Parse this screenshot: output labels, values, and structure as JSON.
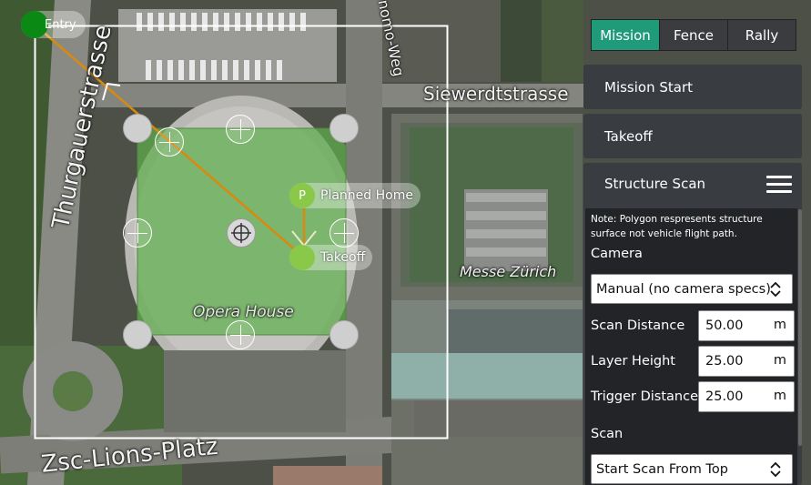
{
  "map": {
    "labels": {
      "thurgauerstrasse": "Thurgauerstrasse",
      "siewerdtstrasse": "Siewerdtstrasse",
      "homo_weg": "nomo-Weg",
      "messe_zurich": "Messe Zürich",
      "opera_house": "Opera House",
      "zsc_lions_platz": "Zsc-Lions-Platz"
    },
    "entry_label": "Entry",
    "planned_home": {
      "letter": "P",
      "label": "Planned Home"
    },
    "takeoff_label": "Takeoff",
    "colors": {
      "polygon": "#5fae4e",
      "path": "#d88a10",
      "entry": "#0a8a14",
      "pin": "#8ac84a"
    }
  },
  "panel": {
    "tabs": [
      {
        "label": "Mission",
        "active": true
      },
      {
        "label": "Fence",
        "active": false
      },
      {
        "label": "Rally",
        "active": false
      }
    ],
    "mission_start": "Mission Start",
    "takeoff": "Takeoff",
    "structure_scan": {
      "title": "Structure Scan",
      "menu_icon": "hamburger-icon",
      "note": "Note: Polygon respresents structure surface not vehicle flight path.",
      "camera_label": "Camera",
      "camera_value": "Manual (no camera specs)",
      "fields": [
        {
          "label": "Scan Distance",
          "value": "50.00",
          "unit": "m"
        },
        {
          "label": "Layer Height",
          "value": "25.00",
          "unit": "m"
        },
        {
          "label": "Trigger Distance",
          "value": "25.00",
          "unit": "m"
        }
      ],
      "scan_label": "Scan",
      "scan_value": "Start Scan From Top"
    },
    "colors": {
      "accent": "#1f9b7a",
      "panel": "#393c40"
    }
  }
}
